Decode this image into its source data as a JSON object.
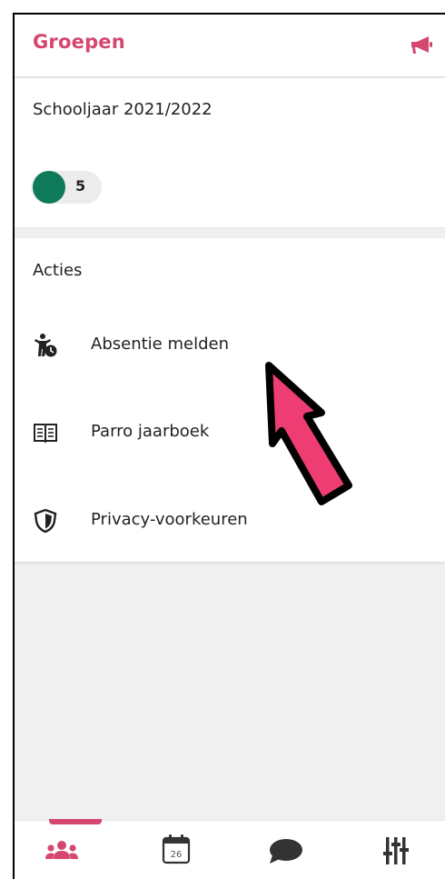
{
  "header": {
    "title": "Groepen",
    "announcement_icon": "megaphone-icon"
  },
  "school": {
    "year_label": "Schooljaar 2021/2022",
    "group": {
      "color": "#0e7a5a",
      "count": "5"
    }
  },
  "actions": {
    "title": "Acties",
    "items": [
      {
        "label": "Absentie melden",
        "icon": "child-clock-icon"
      },
      {
        "label": "Parro jaarboek",
        "icon": "book-icon"
      },
      {
        "label": "Privacy-voorkeuren",
        "icon": "shield-icon"
      }
    ]
  },
  "tabbar": {
    "tabs": [
      {
        "icon": "groups-icon",
        "active": true
      },
      {
        "icon": "calendar-icon",
        "calendar_day": "26",
        "active": false
      },
      {
        "icon": "chat-bubble-icon",
        "active": false
      },
      {
        "icon": "settings-sliders-icon",
        "active": false
      }
    ]
  },
  "colors": {
    "accent": "#d6476f",
    "group_dot": "#0e7a5a",
    "annotation_arrow": "#ee3d73"
  }
}
